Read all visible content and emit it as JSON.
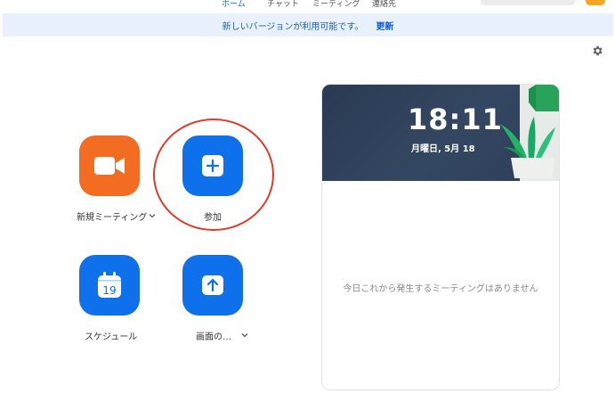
{
  "nav": {
    "home": "ホーム",
    "chat": "チャット",
    "meetings": "ミーティング",
    "contacts": "連絡先"
  },
  "banner": {
    "message": "新しいバージョンが利用可能です。",
    "update_link": "更新"
  },
  "actions": {
    "new_meeting": "新規ミーティング",
    "join": "参加",
    "schedule": "スケジュール",
    "share_screen": "画面の…",
    "calendar_day": "19"
  },
  "panel": {
    "time": "18:11",
    "date": "月曜日, 5月 18",
    "empty_message": "今日これから発生するミーティングはありません"
  },
  "colors": {
    "accent_blue": "#0e71eb",
    "new_meeting_orange": "#f26d21",
    "highlight_red": "#e03a2b",
    "banner_bg": "#e8f1fd"
  },
  "icons": {
    "settings": "gear-icon",
    "new_meeting": "video-camera-icon",
    "join": "plus-icon",
    "schedule": "calendar-icon",
    "share_screen": "share-arrow-icon",
    "dropdown": "chevron-down-icon"
  }
}
